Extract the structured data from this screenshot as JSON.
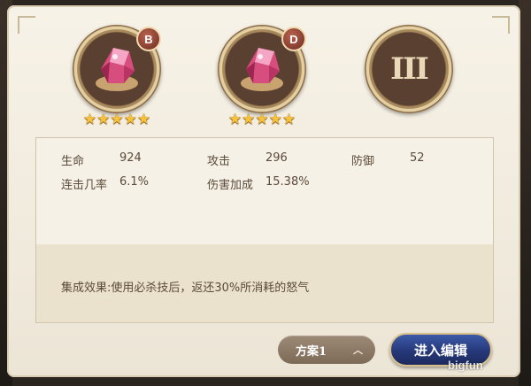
{
  "slots": [
    {
      "type": "gem",
      "grade": "B",
      "stars": 5,
      "icon": "pink-crystal-icon"
    },
    {
      "type": "gem",
      "grade": "D",
      "stars": 5,
      "icon": "pink-crystal-icon"
    },
    {
      "type": "locked",
      "numeral": "III"
    }
  ],
  "stats": {
    "hp_label": "生命",
    "hp_value": "924",
    "atk_label": "攻击",
    "atk_value": "296",
    "def_label": "防御",
    "def_value": "52",
    "combo_label": "连击几率",
    "combo_value": "6.1%",
    "dmg_label": "伤害加成",
    "dmg_value": "15.38%"
  },
  "effect_text": "集成效果:使用必杀技后，返还30%所消耗的怒气",
  "buttons": {
    "scheme_label": "方案1",
    "edit_label": "进入编辑"
  },
  "watermark": "bigfun",
  "colors": {
    "panel": "#f3eee2",
    "text": "#5b4a39",
    "edit_button": "#26387a",
    "star": "#f6c23a"
  }
}
